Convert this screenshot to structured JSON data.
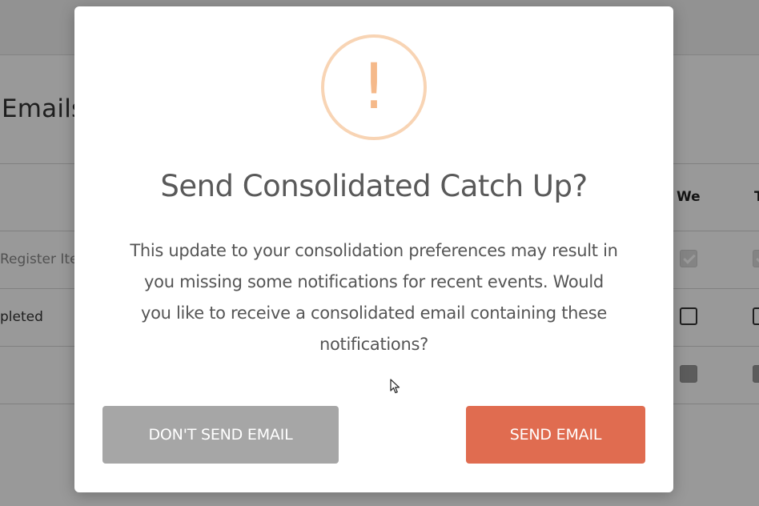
{
  "background": {
    "section_title": "Emails",
    "column_headers": [
      "We",
      "T"
    ],
    "rows": [
      {
        "label": "Register Ite",
        "state": "checked"
      },
      {
        "label": "pleted",
        "state": "empty"
      },
      {
        "label": "",
        "state": "filled"
      }
    ]
  },
  "modal": {
    "icon": "warning-exclamation-icon",
    "icon_glyph": "!",
    "title": "Send Consolidated Catch Up?",
    "body_lines": [
      "This update to your consolidation preferences may result in",
      "you missing some notifications for recent events. Would",
      "you like to receive a consolidated email containing these",
      "notifications?"
    ],
    "buttons": {
      "cancel_label": "DON'T SEND EMAIL",
      "confirm_label": "SEND EMAIL"
    }
  },
  "colors": {
    "confirm_button": "#e06c50",
    "cancel_button": "#a6a6a6",
    "warning_icon": "#f5b98a"
  }
}
